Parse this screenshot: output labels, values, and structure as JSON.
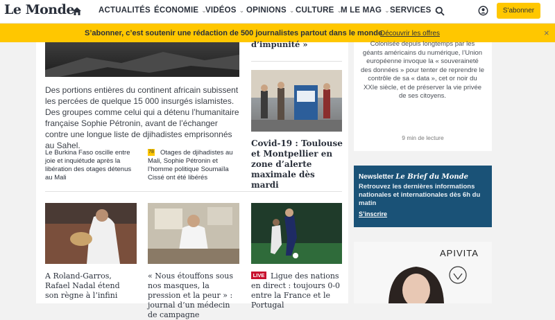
{
  "header": {
    "logo": "Le Monde",
    "nav": [
      {
        "label": "ACTUALITÉS",
        "has_menu": true
      },
      {
        "label": "ÉCONOMIE",
        "has_menu": true
      },
      {
        "label": "VIDÉOS",
        "has_menu": true
      },
      {
        "label": "OPINIONS",
        "has_menu": true
      },
      {
        "label": "CULTURE",
        "has_menu": true
      },
      {
        "label": "M LE MAG",
        "has_menu": true
      },
      {
        "label": "SERVICES",
        "has_menu": true
      }
    ],
    "subscribe_label": "S'abonner",
    "icons": [
      "home-icon",
      "search-icon",
      "user-account-icon"
    ]
  },
  "banner": {
    "text": "S’abonner, c’est soutenir une rédaction de 500 journalistes partout dans le monde",
    "link": "Découvrir les offres",
    "close": "×"
  },
  "lead": {
    "text": "Des portions entières du continent africain subissent les percées de quelque 15 000 insurgés islamistes. Des groupes comme celui qui a détenu l’humanitaire française Sophie Pétronin, avant de l’échanger contre une longue liste de djihadistes emprisonnés au Sahel.",
    "related": [
      {
        "text": "Le Burkina Faso oscille entre joie et inquiétude après la libération des otages détenus au Mali"
      },
      {
        "text": "Otages de djihadistes au Mali, Sophie Pétronin et l’homme politique Soumaïla Cissé ont été libérés",
        "badge": "78"
      }
    ]
  },
  "column_right": {
    "top_title_fragment": "d’impunité »",
    "covid_title": "Covid-19 : Toulouse et Montpellier en zone d’alerte maximale dès mardi"
  },
  "sidebar": {
    "text": "Colonisée depuis longtemps par les géants américains du numérique, l’Union européenne invoque la « souveraineté des données » pour tenter de reprendre le contrôle de sa « data », cet or noir du XXIe siècle, et de préserver la vie privée de ses citoyens.",
    "reading_time": "9 min de lecture",
    "newsletter": {
      "title_prefix": "Newsletter ",
      "title_italic": "Le Brief du Monde",
      "desc": "Retrouvez les dernières informations nationales et internationales dès 6h du matin",
      "link": "S’inscrire"
    },
    "ad_brand": "APIVITA"
  },
  "cards": [
    {
      "title": "A Roland-Garros, Rafael Nadal étend son règne à l’infini"
    },
    {
      "title": "« Nous étouffons sous nos masques, la pression et la peur » : journal d’un médecin de campagne"
    },
    {
      "title": "Ligue des nations en direct : toujours 0-0 entre la France et le Portugal",
      "badge": "LIVE"
    }
  ],
  "colors": {
    "accent": "#ffc700",
    "newsletter_bg": "#1a5277",
    "live": "#c8102e"
  }
}
